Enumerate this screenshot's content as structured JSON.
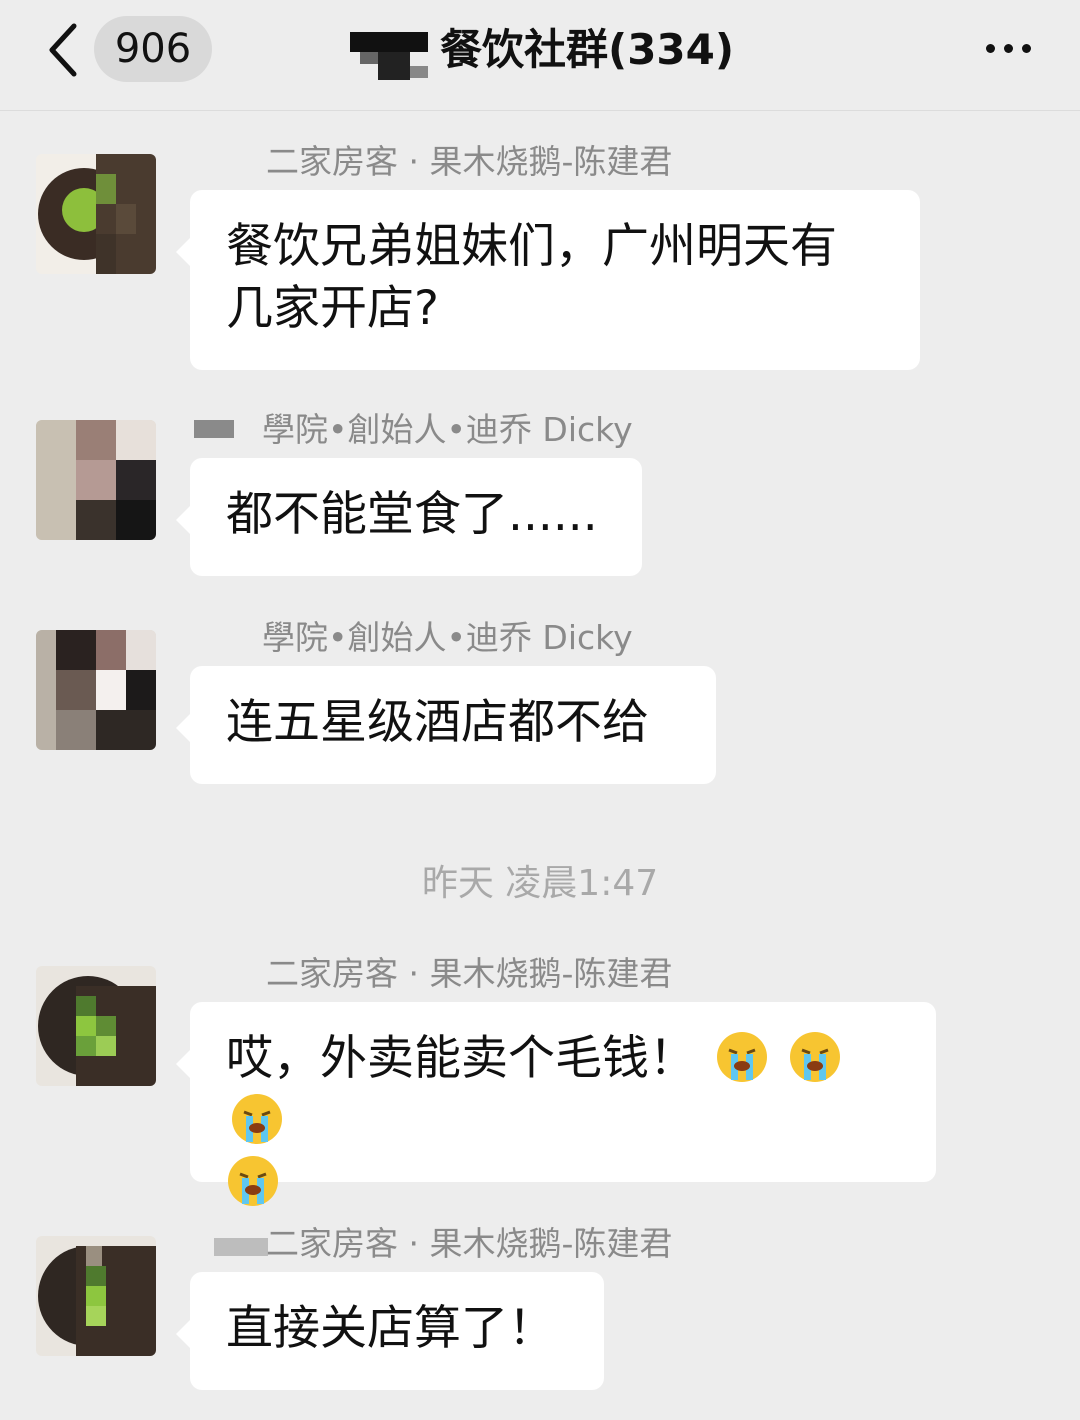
{
  "header": {
    "back_icon": "chevron-left-icon",
    "unread_count": "906",
    "title": "餐饮社群(334)",
    "more_icon": "more-dots-icon"
  },
  "messages": [
    {
      "sender": "二家房客 · 果木烧鹅-陈建君",
      "text_lines": [
        "餐饮兄弟姐妹们，广州明天有",
        "几家开店?"
      ]
    },
    {
      "sender": "學院•創始人•迪乔 Dicky",
      "text_lines": [
        "都不能堂食了......"
      ]
    },
    {
      "sender": "學院•創始人•迪乔 Dicky",
      "text_lines": [
        "连五星级酒店都不给"
      ]
    },
    {
      "sender": "二家房客 · 果木烧鹅-陈建君",
      "text_lines": [
        "哎，外卖能卖个毛钱！",
        ""
      ],
      "emojis": [
        "crying-emoji",
        "crying-emoji",
        "crying-emoji",
        "crying-emoji"
      ]
    },
    {
      "sender": "二家房客 · 果木烧鹅-陈建君",
      "text_lines": [
        "直接关店算了！"
      ]
    }
  ],
  "timestamp": "昨天 凌晨1:47"
}
